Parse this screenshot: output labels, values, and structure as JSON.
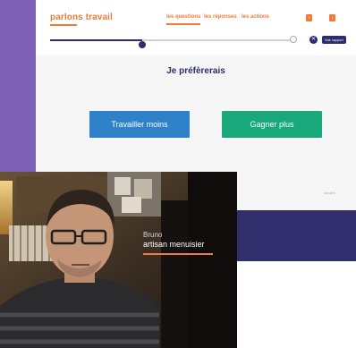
{
  "header": {
    "brand": "parlons travail",
    "nav": [
      "les questions",
      "les réponses",
      "les actions"
    ],
    "mini_buttons": [
      "f",
      "t"
    ]
  },
  "progress": {
    "value": 0.38,
    "knob_label": ""
  },
  "actions": {
    "close_symbol": "✕",
    "report_label": "Voir rapport"
  },
  "question": {
    "title": "Je préfèrerais",
    "choices": [
      "Travailler moins",
      "Gagner plus"
    ]
  },
  "next_label": "suivant",
  "video": {
    "person_name": "Bruno",
    "person_role": "artisan menuisier"
  },
  "colors": {
    "accent": "#f07a3a",
    "navy": "#2b2d6e",
    "blue": "#2f81c8",
    "green": "#19a87a",
    "footer": "#312f6e",
    "purple": "#7c61b5"
  }
}
